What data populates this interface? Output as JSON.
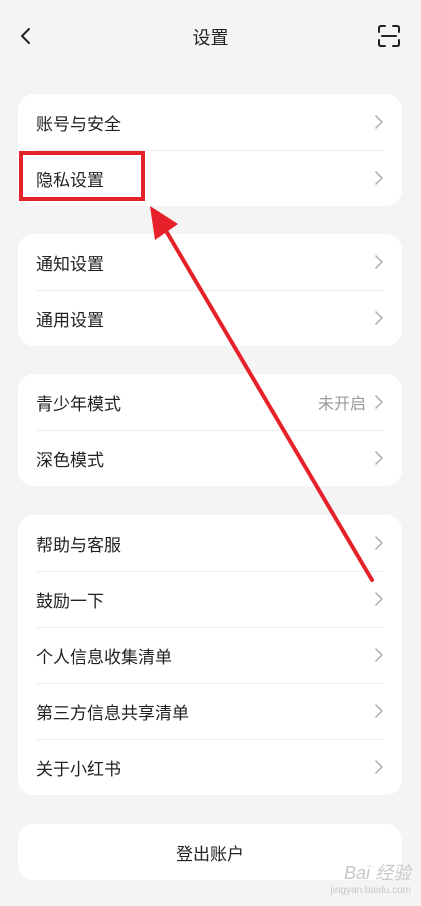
{
  "header": {
    "title": "设置",
    "back_icon": "chevron-left-icon",
    "scan_icon": "scan-icon"
  },
  "groups": [
    {
      "items": [
        {
          "label": "账号与安全"
        },
        {
          "label": "隐私设置"
        }
      ]
    },
    {
      "items": [
        {
          "label": "通知设置"
        },
        {
          "label": "通用设置"
        }
      ]
    },
    {
      "items": [
        {
          "label": "青少年模式",
          "value": "未开启"
        },
        {
          "label": "深色模式"
        }
      ]
    },
    {
      "items": [
        {
          "label": "帮助与客服"
        },
        {
          "label": "鼓励一下"
        },
        {
          "label": "个人信息收集清单"
        },
        {
          "label": "第三方信息共享清单"
        },
        {
          "label": "关于小红书"
        }
      ]
    }
  ],
  "logout": {
    "label": "登出账户"
  },
  "annotation": {
    "color": "#e5212a"
  },
  "watermark": {
    "line1": "Bai 经验",
    "line2": "jingyan.baidu.com"
  }
}
